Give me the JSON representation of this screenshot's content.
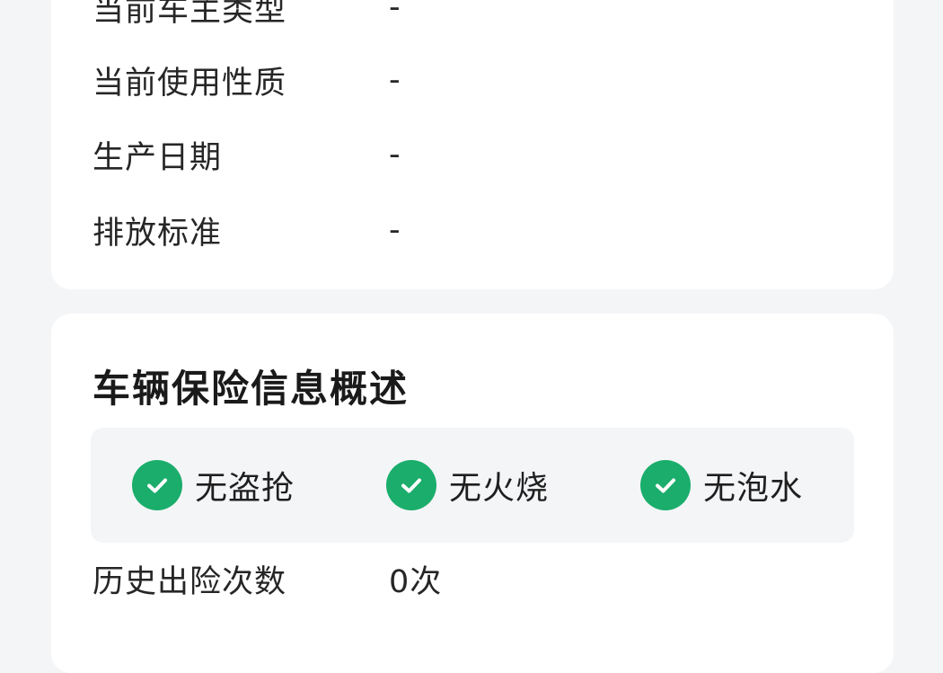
{
  "vehicle_info": {
    "rows": [
      {
        "label": "当前车主类型",
        "value": "-"
      },
      {
        "label": "当前使用性质",
        "value": "-"
      },
      {
        "label": "生产日期",
        "value": "-"
      },
      {
        "label": "排放标准",
        "value": "-"
      }
    ]
  },
  "insurance": {
    "title": "车辆保险信息概述",
    "badges": [
      {
        "label": "无盗抢",
        "icon": "check-circle-icon",
        "color": "#1aad6b"
      },
      {
        "label": "无火烧",
        "icon": "check-circle-icon",
        "color": "#1aad6b"
      },
      {
        "label": "无泡水",
        "icon": "check-circle-icon",
        "color": "#1aad6b"
      }
    ],
    "claims": {
      "label": "历史出险次数",
      "value": "0次"
    }
  }
}
